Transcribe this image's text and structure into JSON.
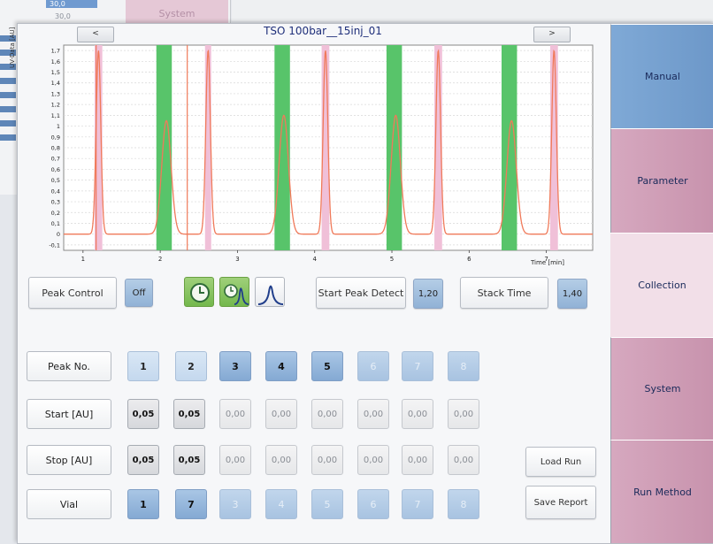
{
  "background": {
    "table_value": "30,0",
    "table_header": "30,0",
    "tab_label": "System"
  },
  "chart_header": {
    "title": "TSO 100bar__15inj_01",
    "prev_label": "<",
    "next_label": ">"
  },
  "chart_data": {
    "type": "line",
    "title": "TSO 100bar__15inj_01",
    "ylabel": "UV-Data [AU]",
    "xlabel": "Time [min]",
    "xlim": [
      0.75,
      7.6
    ],
    "ylim": [
      -0.15,
      1.75
    ],
    "xticks": [
      "1",
      "2",
      "3",
      "4",
      "5",
      "6",
      "7"
    ],
    "yticks": [
      "-0,1",
      "0",
      "0,1",
      "0,2",
      "0,3",
      "0,4",
      "0,5",
      "0,6",
      "0,7",
      "0,8",
      "0,9",
      "1",
      "1,1",
      "1,2",
      "1,3",
      "1,4",
      "1,5",
      "1,6",
      "1,7"
    ],
    "baseline": 0.0,
    "peaks": [
      {
        "center": 1.2,
        "height": 1.7,
        "width": 0.03
      },
      {
        "center": 2.08,
        "height": 1.05,
        "width": 0.06
      },
      {
        "center": 2.62,
        "height": 1.7,
        "width": 0.03
      },
      {
        "center": 3.6,
        "height": 1.1,
        "width": 0.06
      },
      {
        "center": 4.14,
        "height": 1.7,
        "width": 0.03
      },
      {
        "center": 5.05,
        "height": 1.1,
        "width": 0.06
      },
      {
        "center": 5.6,
        "height": 1.7,
        "width": 0.03
      },
      {
        "center": 6.55,
        "height": 1.05,
        "width": 0.06
      },
      {
        "center": 7.1,
        "height": 1.7,
        "width": 0.03
      }
    ],
    "collect_windows": [
      [
        1.95,
        2.15
      ],
      [
        3.48,
        3.68
      ],
      [
        4.93,
        5.13
      ],
      [
        6.42,
        6.62
      ]
    ],
    "pink_windows": [
      [
        1.15,
        1.25
      ],
      [
        2.58,
        2.66
      ],
      [
        4.09,
        4.19
      ],
      [
        5.55,
        5.65
      ],
      [
        7.05,
        7.15
      ]
    ],
    "markers": [
      1.17,
      2.35
    ]
  },
  "controls": {
    "peak_control_label": "Peak Control",
    "peak_control_state": "Off",
    "start_peak_detect_label": "Start Peak Detect",
    "start_peak_detect_value": "1,20",
    "stack_time_label": "Stack Time",
    "stack_time_value": "1,40"
  },
  "grid": {
    "row_labels": {
      "peak": "Peak No.",
      "start": "Start  [AU]",
      "stop": "Stop  [AU]",
      "vial": "Vial"
    },
    "peaks": [
      "1",
      "2",
      "3",
      "4",
      "5",
      "6",
      "7",
      "8"
    ],
    "start": [
      "0,05",
      "0,05",
      "0,00",
      "0,00",
      "0,00",
      "0,00",
      "0,00",
      "0,00"
    ],
    "stop": [
      "0,05",
      "0,05",
      "0,00",
      "0,00",
      "0,00",
      "0,00",
      "0,00",
      "0,00"
    ],
    "vial": [
      "1",
      "7",
      "3",
      "4",
      "5",
      "6",
      "7",
      "8"
    ]
  },
  "actions": {
    "load_run": "Load Run",
    "save_report": "Save Report"
  },
  "sidebar": {
    "manual": "Manual",
    "parameter": "Parameter",
    "collection": "Collection",
    "system": "System",
    "run_method": "Run Method"
  },
  "colors": {
    "trace": "#f07a5a",
    "collect": "#58c46a",
    "pink": "#f0c0d8",
    "accent_blue": "#8fb0d6",
    "active_tab": "#f2dfe8"
  }
}
